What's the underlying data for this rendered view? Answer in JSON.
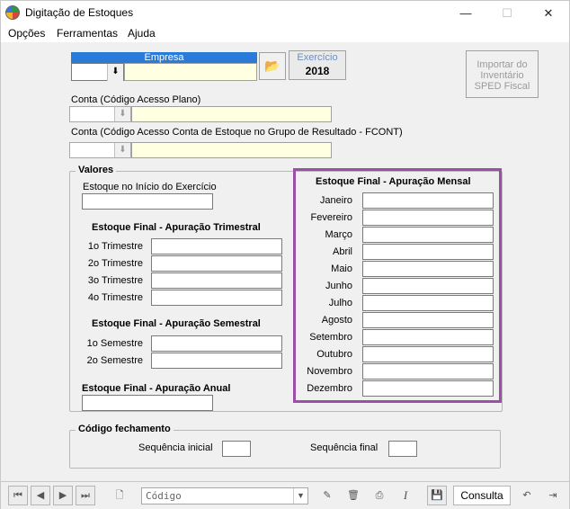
{
  "window": {
    "title": "Digitação de Estoques",
    "minimize": "—",
    "maximize": "☐",
    "close": "✕"
  },
  "menu": [
    {
      "label": "Opções"
    },
    {
      "label": "Ferramentas"
    },
    {
      "label": "Ajuda"
    }
  ],
  "empresa": {
    "label": "Empresa",
    "code": "",
    "name": ""
  },
  "exercicio": {
    "label": "Exercício",
    "value": "2018"
  },
  "import_button": {
    "line1": "Importar do",
    "line2": "Inventário",
    "line3": "SPED Fiscal"
  },
  "conta_plano": {
    "label": "Conta (Código Acesso Plano)",
    "code": "",
    "name": ""
  },
  "conta_fcont": {
    "label": "Conta (Código Acesso Conta de Estoque no Grupo de Resultado - FCONT)",
    "code": "",
    "name": ""
  },
  "valores": {
    "title": "Valores",
    "inicio_label": "Estoque no Início do Exercício",
    "inicio_value": "",
    "trimestral": {
      "title": "Estoque Final - Apuração Trimestral",
      "items": [
        {
          "label": "1o Trimestre",
          "value": ""
        },
        {
          "label": "2o Trimestre",
          "value": ""
        },
        {
          "label": "3o Trimestre",
          "value": ""
        },
        {
          "label": "4o Trimestre",
          "value": ""
        }
      ]
    },
    "semestral": {
      "title": "Estoque Final - Apuração Semestral",
      "items": [
        {
          "label": "1o Semestre",
          "value": ""
        },
        {
          "label": "2o Semestre",
          "value": ""
        }
      ]
    },
    "anual": {
      "title": "Estoque Final - Apuração Anual",
      "value": ""
    },
    "mensal": {
      "title": "Estoque Final - Apuração Mensal",
      "highlight_color": "#9b4fa6",
      "items": [
        {
          "label": "Janeiro",
          "value": ""
        },
        {
          "label": "Fevereiro",
          "value": ""
        },
        {
          "label": "Março",
          "value": ""
        },
        {
          "label": "Abril",
          "value": ""
        },
        {
          "label": "Maio",
          "value": ""
        },
        {
          "label": "Junho",
          "value": ""
        },
        {
          "label": "Julho",
          "value": ""
        },
        {
          "label": "Agosto",
          "value": ""
        },
        {
          "label": "Setembro",
          "value": ""
        },
        {
          "label": "Outubro",
          "value": ""
        },
        {
          "label": "Novembro",
          "value": ""
        },
        {
          "label": "Dezembro",
          "value": ""
        }
      ]
    }
  },
  "fechamento": {
    "title": "Código fechamento",
    "seq_inicial_label": "Sequência inicial",
    "seq_inicial_value": "",
    "seq_final_label": "Sequência final",
    "seq_final_value": ""
  },
  "toolbar": {
    "combo_placeholder": "Código",
    "mode": "Consulta",
    "icons": [
      "first-record-icon",
      "prev-record-icon",
      "next-record-icon",
      "last-record-icon",
      "new-document-icon",
      "edit-icon",
      "delete-icon",
      "print-icon",
      "italic-icon",
      "save-icon",
      "undo-icon",
      "exit-door-icon"
    ]
  }
}
